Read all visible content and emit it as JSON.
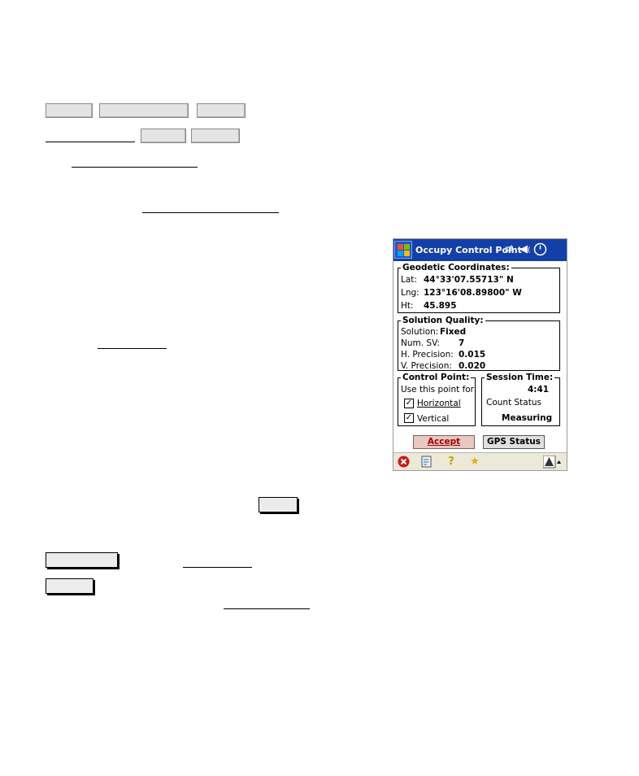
{
  "device": {
    "title": "Occupy Control Point",
    "geodetic": {
      "heading": "Geodetic Coordinates:",
      "lat_label": "Lat:",
      "lat_value": "44°33'07.55713\" N",
      "lng_label": "Lng:",
      "lng_value": "123°16'08.89800\" W",
      "ht_label": "Ht:",
      "ht_value": "45.895"
    },
    "solution": {
      "heading": "Solution Quality:",
      "solution_label": "Solution:",
      "solution_value": "Fixed",
      "numsv_label": "Num. SV:",
      "numsv_value": "7",
      "hprec_label": "H. Precision:",
      "hprec_value": "0.015",
      "vprec_label": "V. Precision:",
      "vprec_value": "0.020"
    },
    "control_point": {
      "heading": "Control Point:",
      "use_label": "Use this point for:",
      "horizontal_label": "Horizontal",
      "horizontal_checked": true,
      "vertical_label": "Vertical",
      "vertical_checked": true
    },
    "session": {
      "heading": "Session Time:",
      "time": "4:41",
      "count_label": "Count Status",
      "status": "Measuring"
    },
    "buttons": {
      "accept": "Accept",
      "gps_status": "GPS Status"
    },
    "icons": [
      "windows-start-icon",
      "connectivity-icon",
      "speaker-icon",
      "clock-icon",
      "close-icon",
      "notes-icon",
      "help-icon",
      "favorites-icon",
      "input-panel-icon"
    ],
    "colors": {
      "titlebar": "#1340a8",
      "accept_bg": "#e8c8c0",
      "accept_text": "#a00000",
      "gps_bg": "#e0e0e0"
    }
  }
}
